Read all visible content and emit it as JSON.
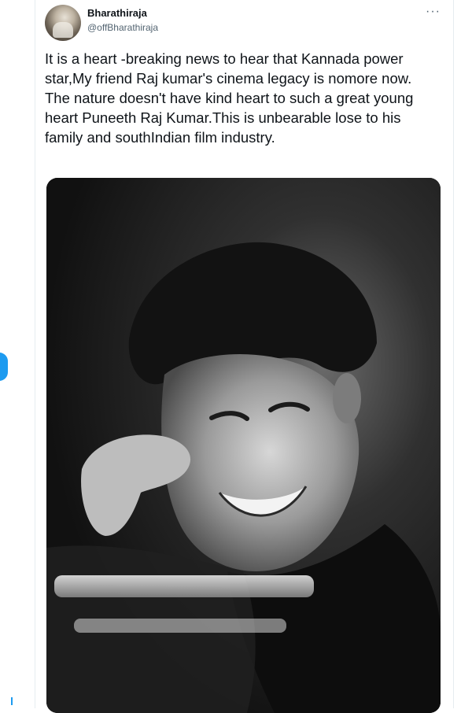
{
  "tweet": {
    "author_name": "Bharathiraja",
    "author_handle": "@offBharathiraja",
    "more_label": "···",
    "text": "It is a heart -breaking news to hear that Kannada power star,My friend Raj kumar's cinema legacy is nomore now. The nature doesn't have kind heart to such a great young heart Puneeth Raj Kumar.This is unbearable lose to his family and southIndian film industry."
  },
  "icons": {
    "more": "more-horizontal-icon"
  },
  "colors": {
    "accent": "#1d9bf0",
    "text": "#0f1419",
    "secondary": "#536471",
    "divider": "#e6ecf0"
  }
}
